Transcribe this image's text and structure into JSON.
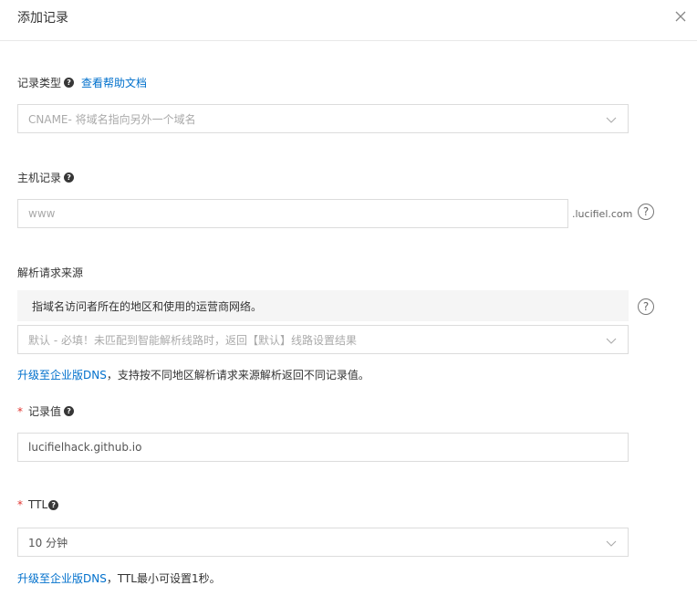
{
  "dialog": {
    "title": "添加记录"
  },
  "record_type": {
    "label": "记录类型",
    "doc_link": "查看帮助文档",
    "value": "CNAME- 将域名指向另外一个域名"
  },
  "host": {
    "label": "主机记录",
    "placeholder": "www",
    "suffix": ".lucifiel.com"
  },
  "source": {
    "label": "解析请求来源",
    "info": "指域名访问者所在的地区和使用的运营商网络。",
    "value": "默认 - 必填！未匹配到智能解析线路时，返回【默认】线路设置结果",
    "upgrade_link": "升级至企业版DNS",
    "upgrade_text": "，支持按不同地区解析请求来源解析返回不同记录值。"
  },
  "record_value": {
    "required_mark": "*",
    "label": "记录值",
    "value": "lucifielhack.github.io"
  },
  "ttl": {
    "required_mark": "*",
    "label": "TTL",
    "value": "10 分钟",
    "upgrade_link": "升级至企业版DNS",
    "upgrade_text": "，TTL最小可设置1秒。"
  },
  "icons": {
    "help_badge": "?",
    "help_circle": "?"
  },
  "colors": {
    "link": "#0070cc",
    "required": "#e1342f",
    "border": "#dcdcdc",
    "info_bg": "#f5f5f5"
  }
}
